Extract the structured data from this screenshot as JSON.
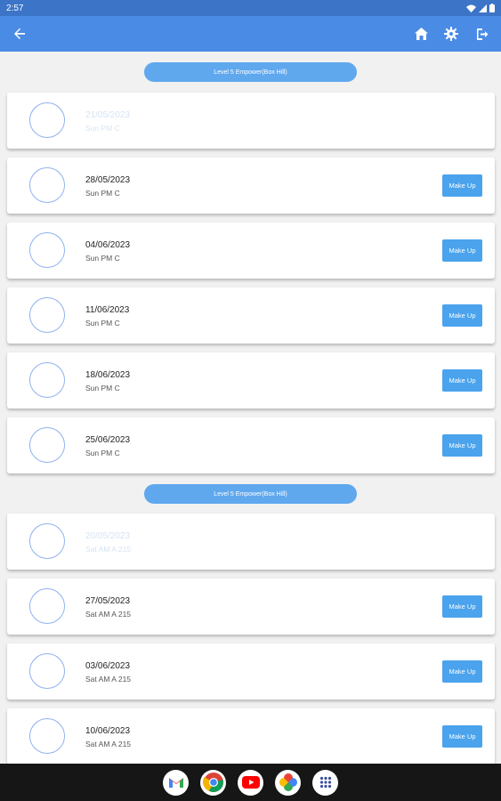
{
  "status": {
    "time": "2:57"
  },
  "appbar": {
    "back_icon": "arrow-left-icon",
    "home_icon": "home-icon",
    "settings_icon": "gear-icon",
    "logout_icon": "logout-icon",
    "color": "#4a8be6"
  },
  "sections": [
    {
      "title": "Level 5 Empower(Box Hill)",
      "items": [
        {
          "date": "21/05/2023",
          "session": "Sun PM C",
          "faded": true,
          "action": ""
        },
        {
          "date": "28/05/2023",
          "session": "Sun PM C",
          "faded": false,
          "action": "Make Up"
        },
        {
          "date": "04/06/2023",
          "session": "Sun PM C",
          "faded": false,
          "action": "Make Up"
        },
        {
          "date": "11/06/2023",
          "session": "Sun PM C",
          "faded": false,
          "action": "Make Up"
        },
        {
          "date": "18/06/2023",
          "session": "Sun PM C",
          "faded": false,
          "action": "Make Up"
        },
        {
          "date": "25/06/2023",
          "session": "Sun PM C",
          "faded": false,
          "action": "Make Up"
        }
      ]
    },
    {
      "title": "Level 5 Empower(Box Hill)",
      "items": [
        {
          "date": "20/05/2023",
          "session": "Sat AM A 215",
          "faded": true,
          "action": ""
        },
        {
          "date": "27/05/2023",
          "session": "Sat AM A 215",
          "faded": false,
          "action": "Make Up"
        },
        {
          "date": "03/06/2023",
          "session": "Sat AM A 215",
          "faded": false,
          "action": "Make Up"
        },
        {
          "date": "10/06/2023",
          "session": "Sat AM A 215",
          "faded": false,
          "action": "Make Up"
        }
      ]
    }
  ],
  "dock": [
    "gmail-icon",
    "chrome-icon",
    "youtube-icon",
    "photos-icon",
    "app-drawer-icon"
  ]
}
